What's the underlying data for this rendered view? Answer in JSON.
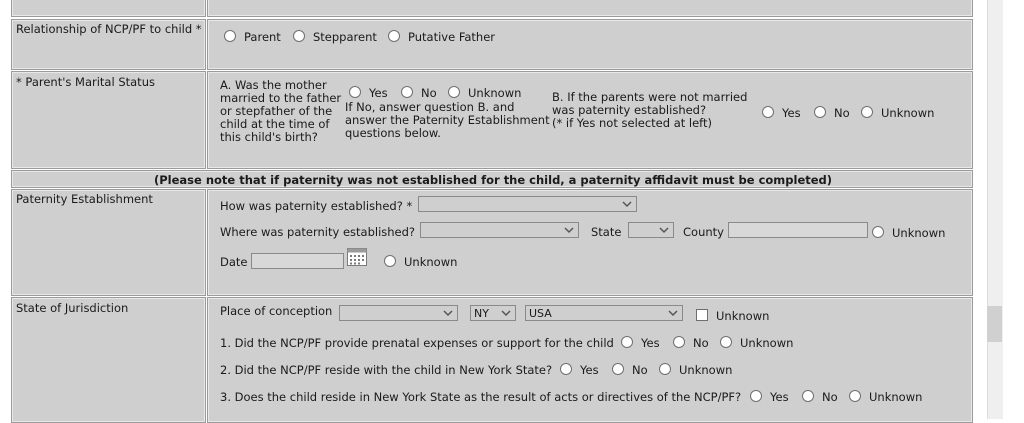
{
  "relationship": {
    "label": "Relationship of NCP/PF to child *",
    "options": [
      "Parent",
      "Stepparent",
      "Putative Father"
    ]
  },
  "marital": {
    "label": "* Parent's Marital Status",
    "question_a": [
      "A. Was the mother",
      "married to the father",
      "or stepfather of the",
      "child at the time of",
      "this child's birth?"
    ],
    "options_a": [
      "Yes",
      "No",
      "Unknown"
    ],
    "note_a": [
      "If No, answer question B. and",
      "answer the Paternity Establishment",
      "questions below."
    ],
    "question_b": [
      "B. If the parents were not married",
      "was paternity established?",
      "(* if Yes not selected at left)"
    ],
    "options_b": [
      "Yes",
      "No",
      "Unknown"
    ]
  },
  "notice": "(Please note that if paternity was not established for the child, a paternity affidavit must be completed)",
  "paternity": {
    "label": "Paternity Establishment",
    "how_label": "How was paternity established? *",
    "how_value": "",
    "where_label": "Where was paternity established?",
    "where_value": "",
    "state_label": "State",
    "state_value": "",
    "county_label": "County",
    "county_value": "",
    "unknown_label": "Unknown",
    "date_label": "Date",
    "date_value": "",
    "date_unknown_label": "Unknown"
  },
  "jurisdiction": {
    "label": "State of Jurisdiction",
    "conception_label": "Place of conception",
    "conception_value": "",
    "state_value": "NY",
    "country_value": "USA",
    "unknown_label": "Unknown",
    "q1": "1. Did the NCP/PF provide prenatal expenses or support for the child",
    "q1_options": [
      "Yes",
      "No",
      "Unknown"
    ],
    "q2": "2. Did the NCP/PF reside with the child in New York State?",
    "q2_options": [
      "Yes",
      "No",
      "Unknown"
    ],
    "q3": "3. Does the child reside in New York State as the result of acts or directives of the NCP/PF?",
    "q3_options": [
      "Yes",
      "No",
      "Unknown"
    ]
  },
  "icons": {
    "dropdown": "chevron-down-icon",
    "calendar": "calendar-icon"
  }
}
